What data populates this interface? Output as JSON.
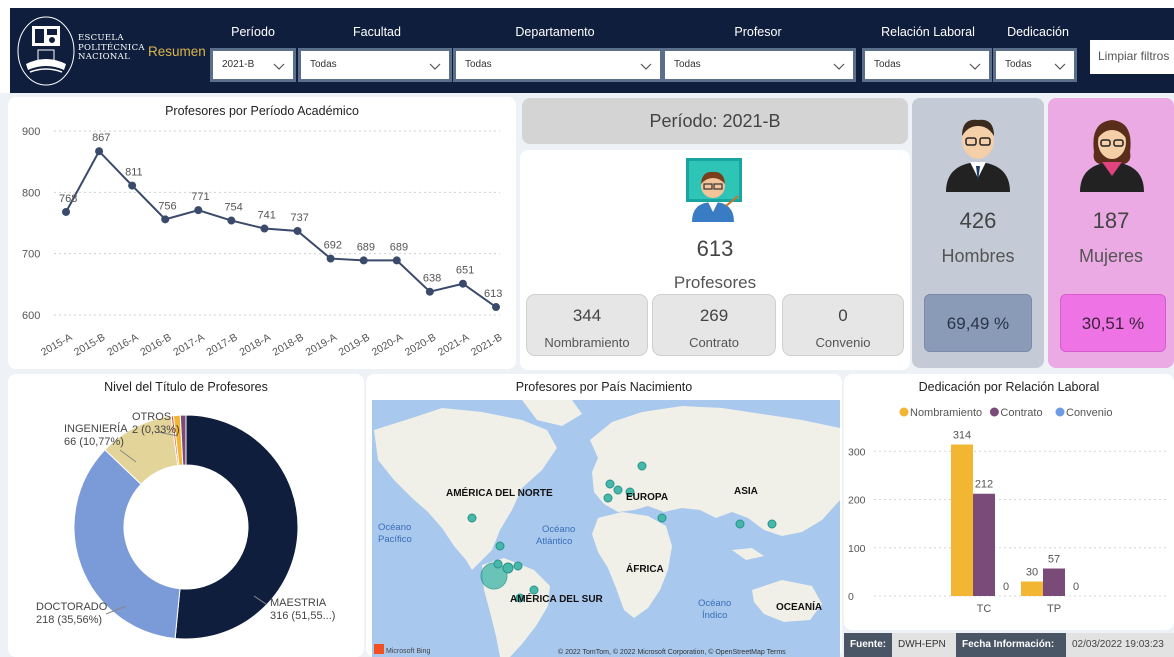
{
  "header": {
    "logo": {
      "line1": "ESCUELA",
      "line2": "POLITÉCNICA",
      "line3": "NACIONAL"
    },
    "page_link": "Resumen",
    "filters": [
      {
        "label": "Período",
        "value": "2021-B"
      },
      {
        "label": "Facultad",
        "value": "Todas"
      },
      {
        "label": "Departamento",
        "value": "Todas"
      },
      {
        "label": "Profesor",
        "value": "Todas"
      },
      {
        "label": "Relación Laboral",
        "value": "Todas"
      },
      {
        "label": "Dedicación",
        "value": "Todas"
      }
    ],
    "clear_button": "Limpiar filtros"
  },
  "line_chart": {
    "title": "Profesores por Período Académico",
    "chart_data": {
      "type": "line",
      "categories": [
        "2015-A",
        "2015-B",
        "2016-A",
        "2016-B",
        "2017-A",
        "2017-B",
        "2018-A",
        "2018-B",
        "2019-A",
        "2019-B",
        "2020-A",
        "2020-B",
        "2021-A",
        "2021-B"
      ],
      "values": [
        768,
        867,
        811,
        756,
        771,
        754,
        741,
        737,
        692,
        689,
        689,
        638,
        651,
        613
      ],
      "yticks": [
        600,
        700,
        800,
        900
      ],
      "ylim": [
        600,
        900
      ],
      "line_color": "#3a4a6b"
    }
  },
  "summary": {
    "period_title": "Período: 2021-B",
    "total_value": "613",
    "total_label": "Profesores",
    "breakdown": [
      {
        "value": "344",
        "label": "Nombramiento"
      },
      {
        "value": "269",
        "label": "Contrato"
      },
      {
        "value": "0",
        "label": "Convenio"
      }
    ],
    "men": {
      "value": "426",
      "label": "Hombres",
      "pct": "69,49 %"
    },
    "women": {
      "value": "187",
      "label": "Mujeres",
      "pct": "30,51 %"
    }
  },
  "donut": {
    "title": "Nivel del Título de Profesores",
    "chart_data": {
      "type": "pie",
      "slices": [
        {
          "name": "MAESTRIA",
          "value": 316,
          "label": "MAESTRIA",
          "sublabel": "316 (51,55...)",
          "color": "#0f1e3d"
        },
        {
          "name": "DOCTORADO",
          "value": 218,
          "label": "DOCTORADO",
          "sublabel": "218 (35,56%)",
          "color": "#7a9bd8"
        },
        {
          "name": "INGENIERÍA",
          "value": 66,
          "label": "INGENIERÍA",
          "sublabel": "66 (10,77%)",
          "color": "#e3d59a"
        },
        {
          "name": "OTROS",
          "value": 2,
          "label": "OTROS",
          "sublabel": "2 (0,33%)",
          "color": "#e0564a"
        },
        {
          "name": "",
          "value": 6,
          "label": "",
          "sublabel": "",
          "color": "#f2b632"
        },
        {
          "name": "",
          "value": 5,
          "label": "",
          "sublabel": "",
          "color": "#7a4a78"
        }
      ]
    }
  },
  "map": {
    "title": "Profesores por País Nacimiento",
    "labels": [
      {
        "text": "AMÉRICA DEL NORTE"
      },
      {
        "text": "EUROPA"
      },
      {
        "text": "ASIA"
      },
      {
        "text": "ÁFRICA"
      },
      {
        "text": "AMÉRICA DEL SUR"
      },
      {
        "text": "OCEANÍA"
      }
    ],
    "oceans": [
      {
        "line1": "Océano",
        "line2": "Pacífico"
      },
      {
        "line1": "Océano",
        "line2": "Atlántico"
      },
      {
        "line1": "Océano",
        "line2": "Índico"
      }
    ],
    "attribution": "© 2022 TomTom, © 2022 Microsoft Corporation, © OpenStreetMap  Terms",
    "bing": "Microsoft Bing"
  },
  "bar_chart": {
    "title": "Dedicación por Relación Laboral",
    "chart_data": {
      "type": "bar",
      "categories": [
        "TC",
        "TP"
      ],
      "series": [
        {
          "name": "Nombramiento",
          "values": [
            314,
            30
          ],
          "color": "#f2b632"
        },
        {
          "name": "Contrato",
          "values": [
            212,
            57
          ],
          "color": "#7a4a78"
        },
        {
          "name": "Convenio",
          "values": [
            0,
            0
          ],
          "color": "#6e9be6"
        }
      ],
      "yticks": [
        0,
        100,
        200,
        300
      ],
      "ylim": [
        0,
        340
      ],
      "legend": "top"
    }
  },
  "footer": {
    "source_label": "Fuente:",
    "source_value": "DWH-EPN",
    "date_label": "Fecha Información:",
    "date_value": "02/03/2022 19:03:23"
  }
}
